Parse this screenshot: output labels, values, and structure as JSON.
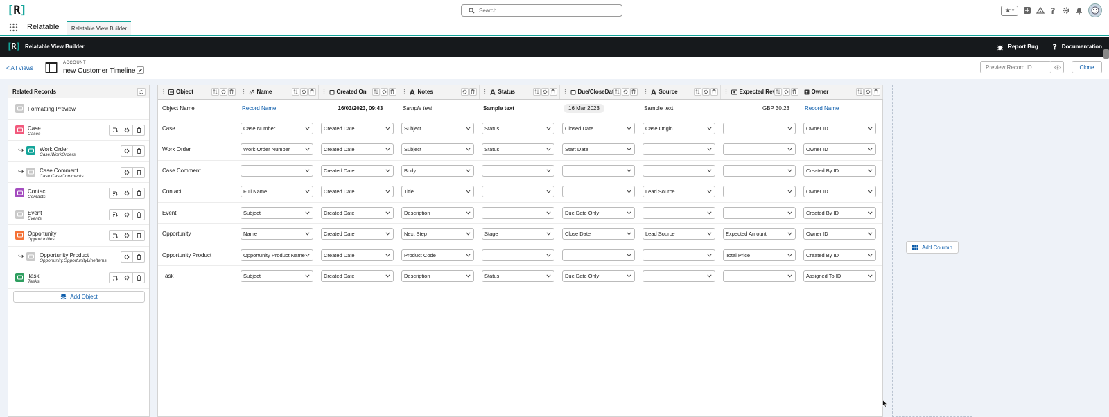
{
  "header": {
    "logo_text": "[R]",
    "search_placeholder": "Search..."
  },
  "app_nav": {
    "app_name": "Relatable",
    "tab_label": "Relatable View Builder"
  },
  "black_bar": {
    "logo_text": "[R]",
    "title": "Relatable View Builder",
    "report_bug": "Report Bug",
    "documentation": "Documentation"
  },
  "sub_header": {
    "all_views": "< All Views",
    "object_type": "ACCOUNT",
    "view_name": "new Customer Timeline",
    "preview_placeholder": "Preview Record ID...",
    "clone_label": "Clone"
  },
  "related_records": {
    "title": "Related Records",
    "add_object_label": "Add Object",
    "items": [
      {
        "label": "Formatting Preview",
        "sub": "",
        "color": "#c9c9c9"
      },
      {
        "label": "Case",
        "sub": "Cases",
        "color": "#f2597c"
      },
      {
        "label": "Work Order",
        "sub": "Case.WorkOrders",
        "color": "#14a59a"
      },
      {
        "label": "Case Comment",
        "sub": "Case.CaseComments",
        "color": "#c9c9c9"
      },
      {
        "label": "Contact",
        "sub": "Contacts",
        "color": "#a44cbf"
      },
      {
        "label": "Event",
        "sub": "Events",
        "color": "#c9c9c9"
      },
      {
        "label": "Opportunity",
        "sub": "Opportunities",
        "color": "#f57236"
      },
      {
        "label": "Opportunity Product",
        "sub": "Opportunity.OpportunityLineItems",
        "color": "#c9c9c9"
      },
      {
        "label": "Task",
        "sub": "Tasks",
        "color": "#2e9e5f"
      }
    ]
  },
  "columns": [
    "Object",
    "Name",
    "Created On",
    "Notes",
    "Status",
    "Due/CloseDate",
    "Source",
    "Expected Reven",
    "Owner"
  ],
  "formatting_row": {
    "object": "Object Name",
    "name": "Record Name",
    "created": "16/03/2023, 09:43",
    "notes": "Sample text",
    "status": "Sample text",
    "due": "16 Mar 2023",
    "source": "Sample text",
    "expected": "GBP 30.23",
    "owner": "Record Name"
  },
  "rows": [
    {
      "object": "Case",
      "name": "Case Number",
      "created": "Created Date",
      "notes": "Subject",
      "status": "Status",
      "due": "Closed Date",
      "source": "Case Origin",
      "expected": "",
      "owner": "Owner ID"
    },
    {
      "object": "Work Order",
      "name": "Work Order Number",
      "created": "Created Date",
      "notes": "Subject",
      "status": "Status",
      "due": "Start Date",
      "source": "",
      "expected": "",
      "owner": "Owner ID"
    },
    {
      "object": "Case Comment",
      "name": "",
      "created": "Created Date",
      "notes": "Body",
      "status": "",
      "due": "",
      "source": "",
      "expected": "",
      "owner": "Created By ID"
    },
    {
      "object": "Contact",
      "name": "Full Name",
      "created": "Created Date",
      "notes": "Title",
      "status": "",
      "due": "",
      "source": "Lead Source",
      "expected": "",
      "owner": "Owner ID"
    },
    {
      "object": "Event",
      "name": "Subject",
      "created": "Created Date",
      "notes": "Description",
      "status": "",
      "due": "Due Date Only",
      "source": "",
      "expected": "",
      "owner": "Created By ID"
    },
    {
      "object": "Opportunity",
      "name": "Name",
      "created": "Created Date",
      "notes": "Next Step",
      "status": "Stage",
      "due": "Close Date",
      "source": "Lead Source",
      "expected": "Expected Amount",
      "owner": "Owner ID"
    },
    {
      "object": "Opportunity Product",
      "name": "Opportunity Product Name",
      "created": "Created Date",
      "notes": "Product Code",
      "status": "",
      "due": "",
      "source": "",
      "expected": "Total Price",
      "owner": "Created By ID"
    },
    {
      "object": "Task",
      "name": "Subject",
      "created": "Created Date",
      "notes": "Description",
      "status": "Status",
      "due": "Due Date Only",
      "source": "",
      "expected": "",
      "owner": "Assigned To ID"
    }
  ],
  "add_column_label": "Add Column",
  "colors": {
    "accent": "#14a59a",
    "link": "#0b5cab",
    "dark_bar": "#16191c"
  }
}
